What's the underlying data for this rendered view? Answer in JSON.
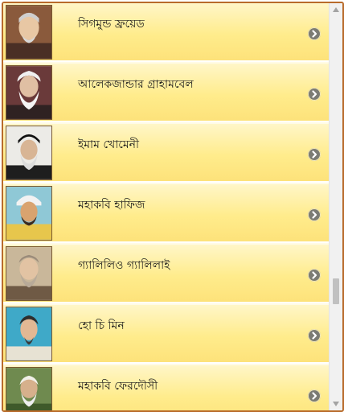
{
  "accent_color": "#b86b2b",
  "row_background": "#ffec8c",
  "items": [
    {
      "name": "সিগমুন্ড ফ্রয়েড",
      "icon": "chevron-right-icon"
    },
    {
      "name": "আলেকজান্ডার গ্রাহামবেল",
      "icon": "chevron-right-icon"
    },
    {
      "name": "ইমাম খোমেনী",
      "icon": "chevron-right-icon"
    },
    {
      "name": "মহাকবি হাফিজ",
      "icon": "chevron-right-icon"
    },
    {
      "name": "গ্যালিলিও গ্যালিলাই",
      "icon": "chevron-right-icon"
    },
    {
      "name": "হো চি মিন",
      "icon": "chevron-right-icon"
    },
    {
      "name": "মহাকবি ফেরদৌসী",
      "icon": "chevron-right-icon"
    }
  ],
  "scrollbar": {
    "position_fraction": 0.68
  }
}
